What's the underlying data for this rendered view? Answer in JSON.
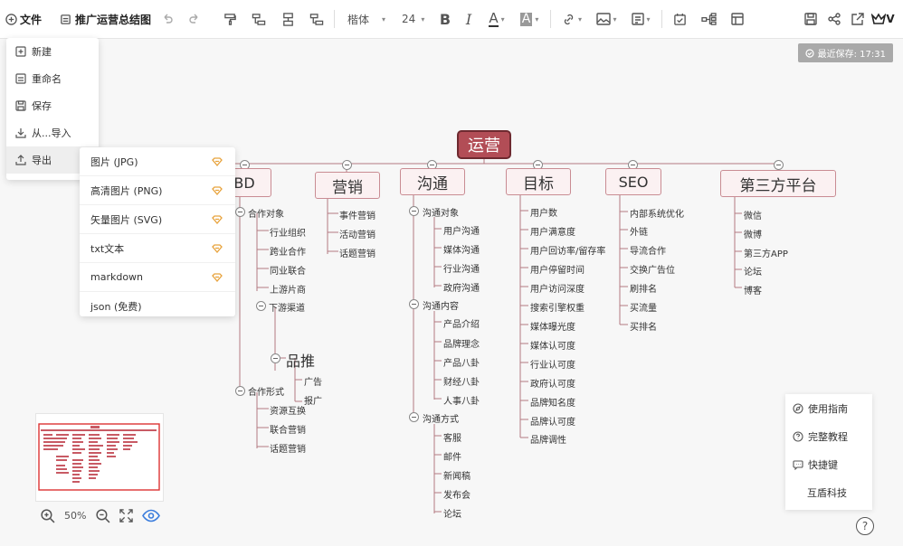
{
  "toolbar": {
    "file_label": "文件",
    "doc_title": "推广运营总结图",
    "font_family": "楷体",
    "font_size": "24",
    "crown_label": "V"
  },
  "save_status": "最近保存: 17:31",
  "file_menu": {
    "items": [
      {
        "label": "新建",
        "icon": "plus-square-icon"
      },
      {
        "label": "重命名",
        "icon": "rename-icon"
      },
      {
        "label": "保存",
        "icon": "save-icon"
      },
      {
        "label": "从...导入",
        "icon": "import-icon"
      },
      {
        "label": "导出",
        "icon": "export-icon"
      }
    ]
  },
  "export_menu": {
    "items": [
      {
        "label": "图片 (JPG)",
        "premium": true
      },
      {
        "label": "高清图片 (PNG)",
        "premium": true
      },
      {
        "label": "矢量图片 (SVG)",
        "premium": true
      },
      {
        "label": "txt文本",
        "premium": true
      },
      {
        "label": "markdown",
        "premium": true
      },
      {
        "label": "json (免费)",
        "premium": false
      }
    ]
  },
  "mindmap": {
    "root": "运营",
    "bd": {
      "title": "BD",
      "coop_obj": "合作对象",
      "coop_obj_children": [
        "行业组织",
        "跨业合作",
        "同业联合",
        "上游片商"
      ],
      "downstream": "下游渠道",
      "pinjie": "品推",
      "pinjie_children": [
        "广告",
        "报广"
      ],
      "coop_form": "合作形式",
      "coop_form_children": [
        "资源互换",
        "联合营销",
        "话题营销"
      ]
    },
    "marketing": {
      "title": "营销",
      "children": [
        "事件营销",
        "活动营销",
        "话题营销"
      ]
    },
    "comm": {
      "title": "沟通",
      "obj": "沟通对象",
      "obj_children": [
        "用户沟通",
        "媒体沟通",
        "行业沟通",
        "政府沟通"
      ],
      "content": "沟通内容",
      "content_children": [
        "产品介绍",
        "品牌理念",
        "产品八卦",
        "财经八卦",
        "人事八卦"
      ],
      "method": "沟通方式",
      "method_children": [
        "客服",
        "邮件",
        "新闻稿",
        "发布会",
        "论坛"
      ]
    },
    "goal": {
      "title": "目标",
      "children": [
        "用户数",
        "用户满意度",
        "用户回访率/留存率",
        "用户停留时间",
        "用户访问深度",
        "搜索引擎权重",
        "媒体曝光度",
        "媒体认可度",
        "行业认可度",
        "政府认可度",
        "品牌知名度",
        "品牌认可度",
        "品牌调性"
      ]
    },
    "seo": {
      "title": "SEO",
      "children": [
        "内部系统优化",
        "外链",
        "导流合作",
        "交换广告位",
        "刷排名",
        "买流量",
        "买排名"
      ]
    },
    "third": {
      "title": "第三方平台",
      "children": [
        "微信",
        "微博",
        "第三方APP",
        "论坛",
        "博客"
      ]
    }
  },
  "zoom_level": "50%",
  "help": {
    "items": [
      "使用指南",
      "完整教程",
      "快捷键"
    ],
    "brand": "互盾科技"
  },
  "colors": {
    "root_fill": "#b24d56",
    "branch_border": "#c98c93",
    "line": "#b37a80",
    "premium": "#e8a33d"
  }
}
